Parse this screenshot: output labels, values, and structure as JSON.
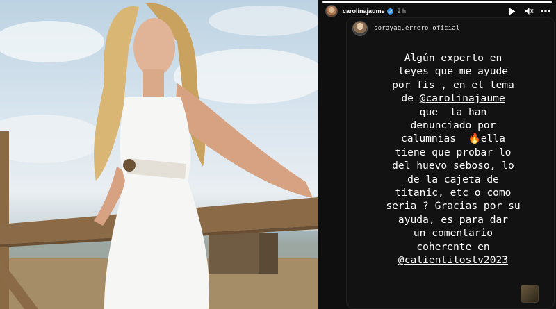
{
  "photo": {
    "alt_subject": "woman-in-white-dress"
  },
  "story": {
    "progress": 1.0,
    "author": "carolinajaume",
    "author_verified": true,
    "time": "2 h",
    "icons": {
      "play": "play-icon",
      "mute": "mute-icon",
      "more": "more-icon"
    },
    "mention": {
      "user": "sorayaguerrero_oficial"
    },
    "text": {
      "line1": "Algún experto en",
      "line2": "leyes que me ayude",
      "line3": "por fis , en el tema",
      "line4_prefix": "de ",
      "mention1": "@carolinajaume",
      "line5": "que  la han",
      "line6": "denunciado por",
      "line7_a": "calumnias  ",
      "fire_emoji": "🔥",
      "line7_b": "ella",
      "line8": "tiene que probar lo",
      "line9": "del huevo seboso, lo",
      "line10": "de la cajeta de",
      "line11": "titanic, etc o como",
      "line12": "seria ? Gracias por su",
      "line13": "ayuda, es para dar",
      "line14": "un comentario",
      "line15": "coherente en",
      "mention2": "@calientitostv2023"
    }
  },
  "colors": {
    "story_bg": "#0f0f0f",
    "verified": "#3897f0",
    "text": "#ffffff"
  }
}
